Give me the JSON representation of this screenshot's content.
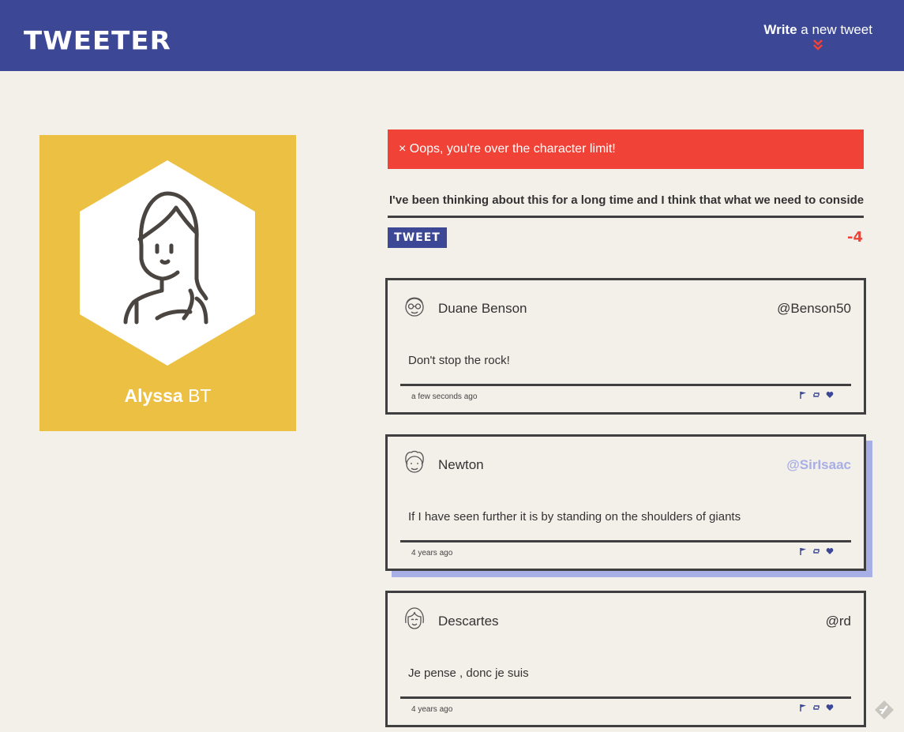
{
  "nav": {
    "logo": "TWEETER",
    "compose_bold": "Write",
    "compose_rest": " a new tweet"
  },
  "profile": {
    "first_name": "Alyssa",
    "last_name": " BT"
  },
  "composer": {
    "error": "× Oops, you're over the character limit!",
    "text": "I've been thinking about this for a long time and I think that what we need to consider",
    "button": "TWEET",
    "counter": "-4"
  },
  "tweets": [
    {
      "author": "Duane Benson",
      "handle": "@Benson50",
      "content": "Don't stop the rock!",
      "time": "a few seconds ago"
    },
    {
      "author": "Newton",
      "handle": "@SirIsaac",
      "content": "If I have seen further it is by standing on the shoulders of giants",
      "time": "4 years ago"
    },
    {
      "author": "Descartes",
      "handle": "@rd",
      "content": "Je pense , donc je suis",
      "time": "4 years ago"
    }
  ],
  "colors": {
    "nav": "#3c4896",
    "page": "#f3efe9",
    "profile": "#ecc042",
    "error": "#f04236",
    "hover_shadow": "#a8afe6"
  }
}
